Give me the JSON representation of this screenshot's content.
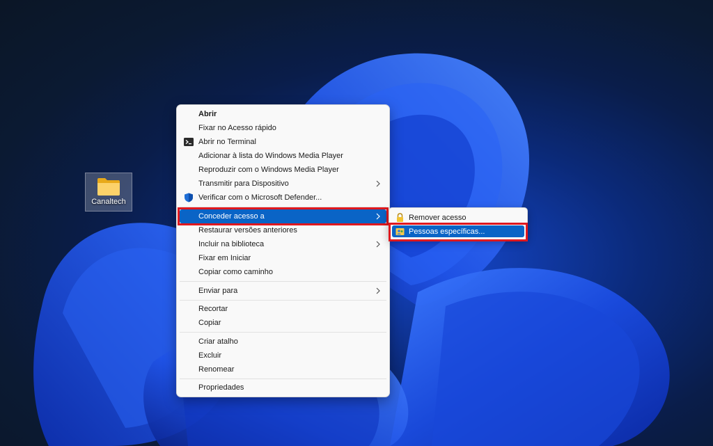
{
  "desktop": {
    "icon_label": "Canaltech",
    "icon_name": "folder-icon"
  },
  "context_menu": {
    "items": [
      {
        "label": "Abrir",
        "bold": true
      },
      {
        "label": "Fixar no Acesso rápido"
      },
      {
        "label": "Abrir no Terminal",
        "icon": "terminal-icon"
      },
      {
        "label": "Adicionar à lista do Windows Media Player"
      },
      {
        "label": "Reproduzir com o Windows Media Player"
      },
      {
        "label": "Transmitir para Dispositivo",
        "submenu": true
      },
      {
        "label": "Verificar com o Microsoft Defender...",
        "icon": "defender-shield-icon"
      },
      {
        "label": "Conceder acesso a",
        "submenu": true,
        "highlighted": true
      },
      {
        "label": "Restaurar versões anteriores"
      },
      {
        "label": "Incluir na biblioteca",
        "submenu": true
      },
      {
        "label": "Fixar em Iniciar"
      },
      {
        "label": "Copiar como caminho"
      },
      {
        "label": "Enviar para",
        "submenu": true
      },
      {
        "label": "Recortar"
      },
      {
        "label": "Copiar"
      },
      {
        "label": "Criar atalho"
      },
      {
        "label": "Excluir"
      },
      {
        "label": "Renomear"
      },
      {
        "label": "Propriedades"
      }
    ]
  },
  "submenu": {
    "items": [
      {
        "label": "Remover acesso",
        "icon": "lock-icon"
      },
      {
        "label": "Pessoas específicas...",
        "icon": "people-icon",
        "highlighted": true
      }
    ]
  },
  "colors": {
    "highlight": "#0a64c6",
    "annotation_red": "#e0181e",
    "menu_bg": "#f9f9f9"
  }
}
